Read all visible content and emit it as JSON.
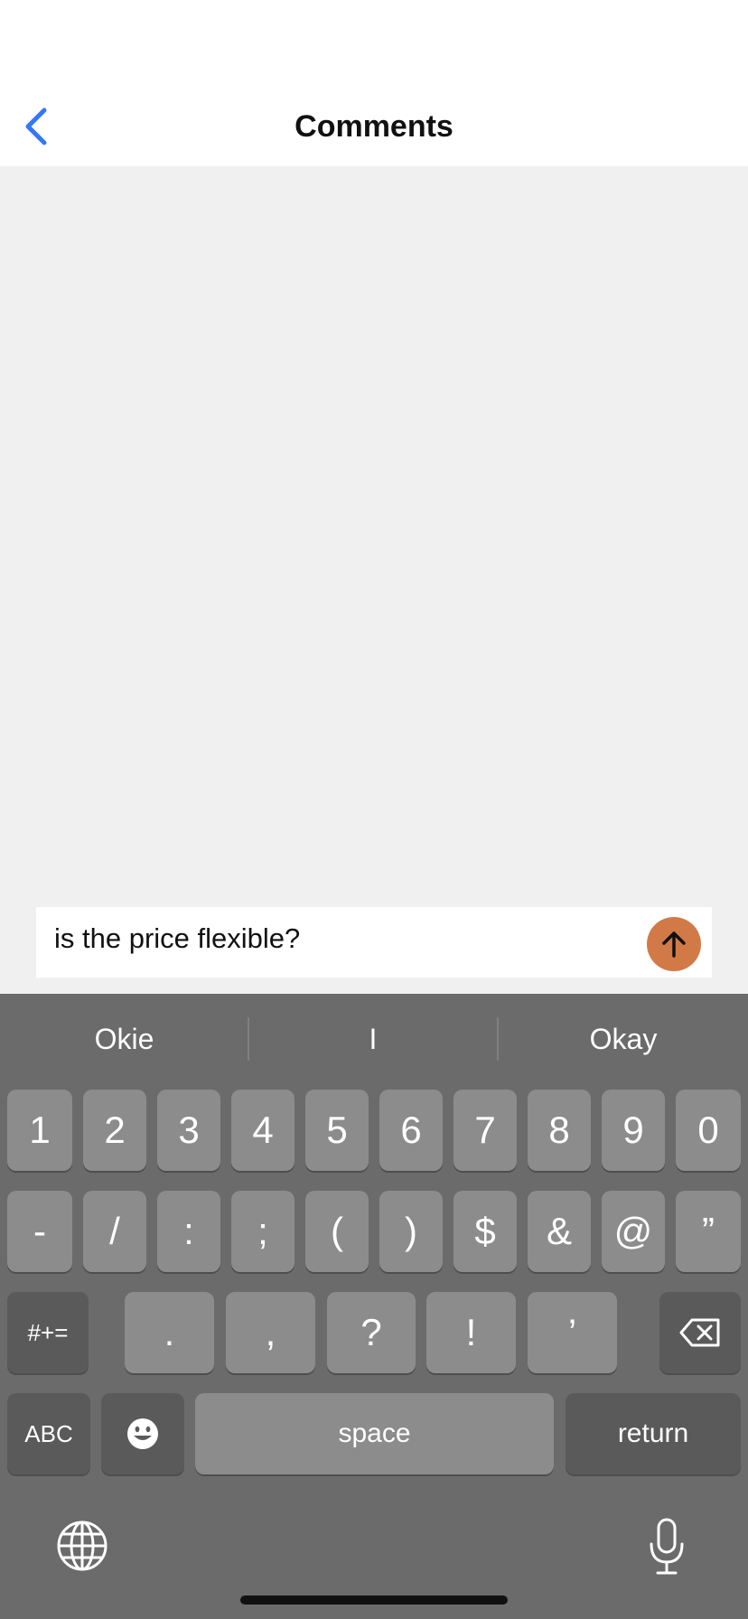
{
  "header": {
    "title": "Comments"
  },
  "composer": {
    "value": "is the price flexible?"
  },
  "suggestions": [
    "Okie",
    "I",
    "Okay"
  ],
  "keyboard": {
    "row1": [
      "1",
      "2",
      "3",
      "4",
      "5",
      "6",
      "7",
      "8",
      "9",
      "0"
    ],
    "row2": [
      "-",
      "/",
      ":",
      ";",
      "(",
      ")",
      "$",
      "&",
      "@",
      "”"
    ],
    "row3": {
      "mode": "#+=",
      "keys": [
        ".",
        ",",
        "?",
        "!",
        "’"
      ]
    },
    "row4": {
      "abc": "ABC",
      "space": "space",
      "return": "return"
    }
  },
  "colors": {
    "accent_send": "#d27a47",
    "back_chevron": "#3478f6"
  },
  "icons": {
    "back": "chevron-left-icon",
    "send": "arrow-up-icon",
    "delete": "delete-key-icon",
    "emoji": "emoji-icon",
    "globe": "globe-icon",
    "mic": "microphone-icon"
  }
}
